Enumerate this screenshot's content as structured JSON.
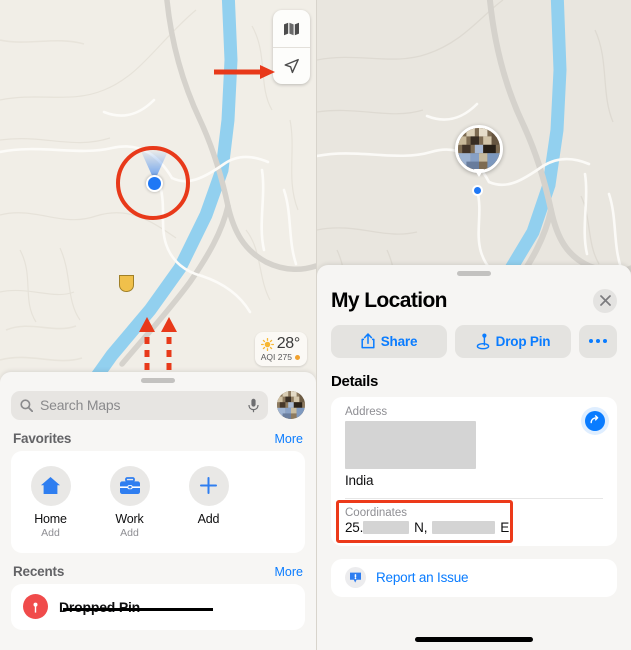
{
  "left": {
    "map_controls": [
      {
        "name": "map-layers-button",
        "icon": "map-book-icon"
      },
      {
        "name": "locate-me-button",
        "icon": "navigation-arrow-icon"
      }
    ],
    "weather": {
      "temperature": "28°",
      "aqi": "AQI 275",
      "icon": "sun-icon"
    },
    "search": {
      "placeholder": "Search Maps",
      "search_icon": "search-icon",
      "mic_icon": "microphone-icon",
      "avatar": "user-avatar"
    },
    "favorites": {
      "title": "Favorites",
      "more": "More",
      "items": [
        {
          "label": "Home",
          "sub": "Add",
          "icon": "home-icon"
        },
        {
          "label": "Work",
          "sub": "Add",
          "icon": "briefcase-icon"
        },
        {
          "label": "Add",
          "sub": "",
          "icon": "plus-icon"
        }
      ]
    },
    "recents": {
      "title": "Recents",
      "more": "More",
      "items": [
        {
          "label": "Dropped Pin",
          "icon": "map-pin-icon"
        }
      ]
    },
    "annotations": {
      "pointer_arrow": "red-arrow-right",
      "drag_up_arrows": "red-dashed-arrows-up"
    }
  },
  "right": {
    "sheet": {
      "title": "My Location",
      "close_icon": "close-icon",
      "actions": [
        {
          "label": "Share",
          "icon": "share-icon",
          "name": "share-button"
        },
        {
          "label": "Drop Pin",
          "icon": "drop-pin-icon",
          "name": "drop-pin-button"
        },
        {
          "label": "",
          "icon": "ellipsis-icon",
          "name": "more-options-button"
        }
      ],
      "details_title": "Details",
      "fields": [
        {
          "label": "Address",
          "redacted": true,
          "value": "India",
          "action_icon": "directions-arrow-icon"
        },
        {
          "label": "Coordinates",
          "lat_prefix": "25.",
          "lat_suffix": "N,",
          "lon_suffix": "E",
          "highlighted": true
        }
      ],
      "report": {
        "label": "Report an Issue",
        "icon": "exclamation-bubble-icon"
      }
    },
    "map": {
      "avatar_pin": "user-avatar-pin",
      "location_dot": "blue-location-dot"
    }
  },
  "colors": {
    "accent_blue": "#0a7cff",
    "annotation_red": "#ec3a1a",
    "map_land": "#f1eee7",
    "map_water": "#92d0ef",
    "map_road": "#d5d2cc",
    "aqi_orange": "#f0a12e"
  }
}
